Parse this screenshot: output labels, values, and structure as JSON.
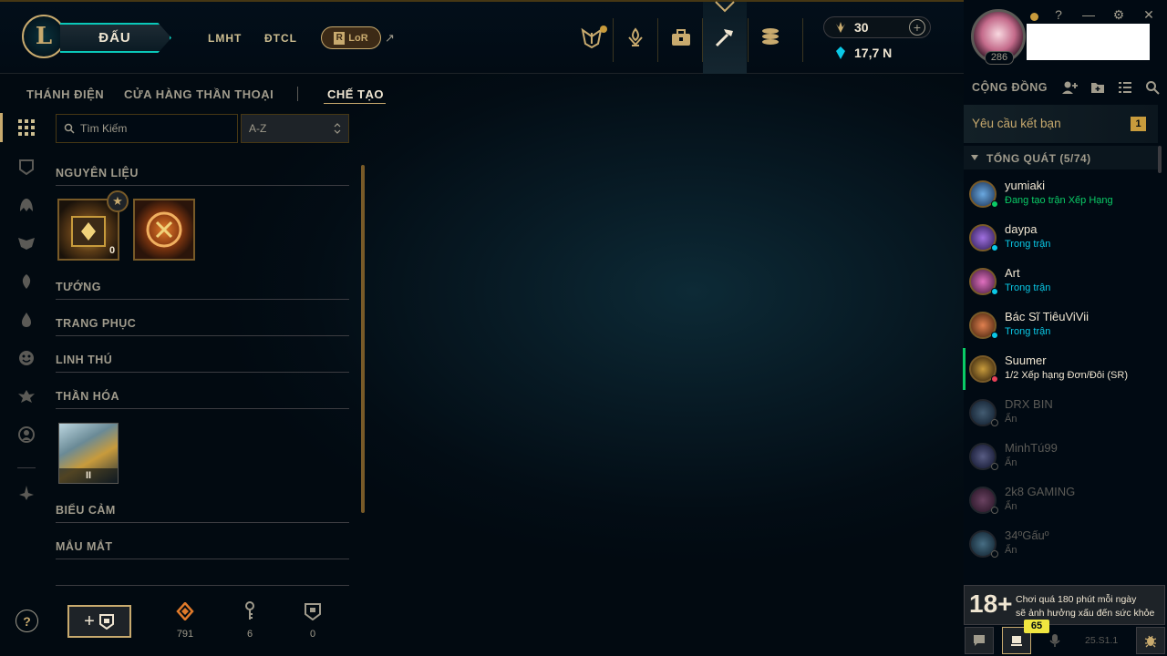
{
  "header": {
    "logo_text": "L",
    "play_button": "ĐẤU",
    "nav": [
      "LMHT",
      "ĐTCL"
    ],
    "lor_button": "LoR",
    "external_link": "↗",
    "currency": {
      "blue_essence": "30",
      "orange_essence": "17,7 N",
      "add": "+"
    },
    "profile": {
      "level": "286"
    },
    "window": {
      "help": "?",
      "minimize": "—",
      "settings": "⚙",
      "close": "✕"
    }
  },
  "subnav": {
    "tabs": [
      "THÁNH ĐIỆN",
      "CỬA HÀNG THẦN THOẠI",
      "CHẾ TẠO"
    ],
    "active": 2
  },
  "loot": {
    "search_placeholder": "Tìm Kiếm",
    "sort_value": "A-Z",
    "sections": {
      "materials": "NGUYÊN LIỆU",
      "champions": "TƯỚNG",
      "skins": "TRANG PHỤC",
      "pets": "LINH THÚ",
      "ward": "THẦN HÓA",
      "emotes": "BIỂU CẢM",
      "eyes": "MẮU MẮT"
    },
    "items": {
      "chest_count": "0",
      "ward_label": "II"
    }
  },
  "footer": {
    "help": "?",
    "add_label": "+",
    "orange_essence": "791",
    "keys": "6",
    "chests": "0"
  },
  "social": {
    "title": "CỘNG ĐỒNG",
    "friend_requests": "Yêu cầu kết bạn",
    "friend_requests_count": "1",
    "group": "TỔNG QUÁT (5/74)",
    "friends": [
      {
        "name": "yumiaki",
        "status": "Đang tạo trận Xếp Hạng",
        "color": "#0acb66"
      },
      {
        "name": "daypa",
        "status": "Trong trận",
        "color": "#0ac8e6"
      },
      {
        "name": "Art",
        "status": "Trong trận",
        "color": "#0ac8e6"
      },
      {
        "name": "Bác Sĩ TiêuViVii",
        "status": "Trong trận",
        "color": "#0ac8e6"
      },
      {
        "name": "Suumer",
        "status": "1/2 Xếp hạng Đơn/Đôi (SR)",
        "color": "#f0e6d2"
      },
      {
        "name": "DRX BIN",
        "status": "Ẩn",
        "color": "#5b5a56"
      },
      {
        "name": "MinhTú99",
        "status": "Ẩn",
        "color": "#5b5a56"
      },
      {
        "name": "2k8 GAMING",
        "status": "Ẩn",
        "color": "#5b5a56"
      },
      {
        "name": "34ºGấuº",
        "status": "Ẩn",
        "color": "#5b5a56"
      }
    ],
    "warning_rating": "18+",
    "warning_text_1": "Chơi quá 180 phút mỗi ngày",
    "warning_text_2": "sẽ ảnh hưởng xấu đến sức khỏe",
    "notif_count": "65",
    "version": "25.S1.1"
  }
}
